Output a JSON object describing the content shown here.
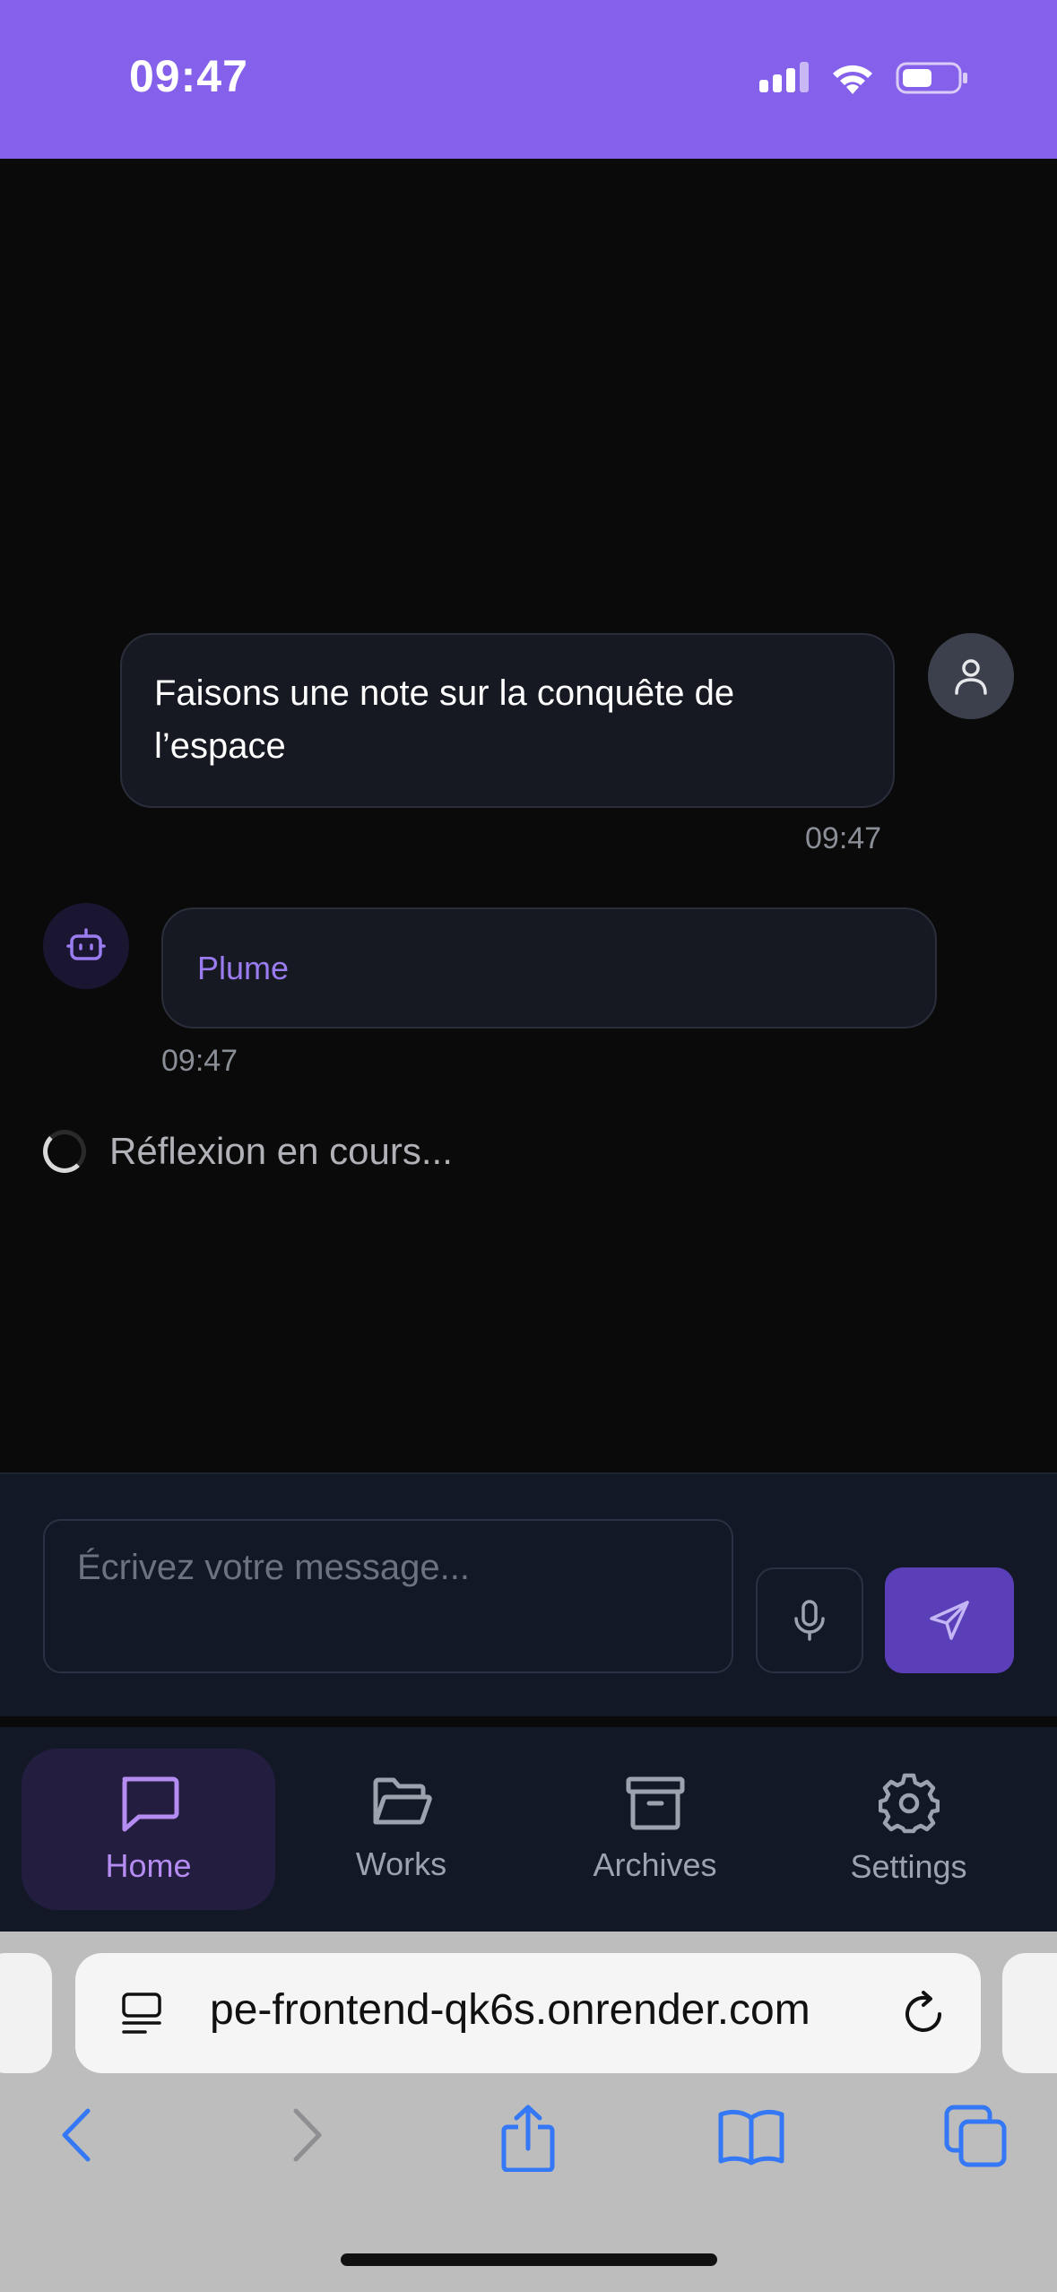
{
  "status_bar": {
    "time": "09:47",
    "bg_color": "#8560ea"
  },
  "chat": {
    "user_message": {
      "text": "Faisons une note sur la conquête de l’espace",
      "time": "09:47",
      "avatar_icon": "user-icon"
    },
    "bot_message": {
      "name": "Plume",
      "time": "09:47",
      "avatar_icon": "bot-icon"
    },
    "thinking_text": "Réflexion en cours..."
  },
  "composer": {
    "placeholder": "Écrivez votre message...",
    "value": "",
    "mic_icon": "microphone-icon",
    "send_icon": "send-icon"
  },
  "nav": {
    "items": [
      {
        "label": "Home",
        "icon": "chat-bubble-icon",
        "active": true
      },
      {
        "label": "Works",
        "icon": "folder-open-icon",
        "active": false
      },
      {
        "label": "Archives",
        "icon": "archive-icon",
        "active": false
      },
      {
        "label": "Settings",
        "icon": "gear-icon",
        "active": false
      }
    ],
    "active_color": "#b48cf2"
  },
  "browser": {
    "url": "pe-frontend-qk6s.onrender.com"
  }
}
